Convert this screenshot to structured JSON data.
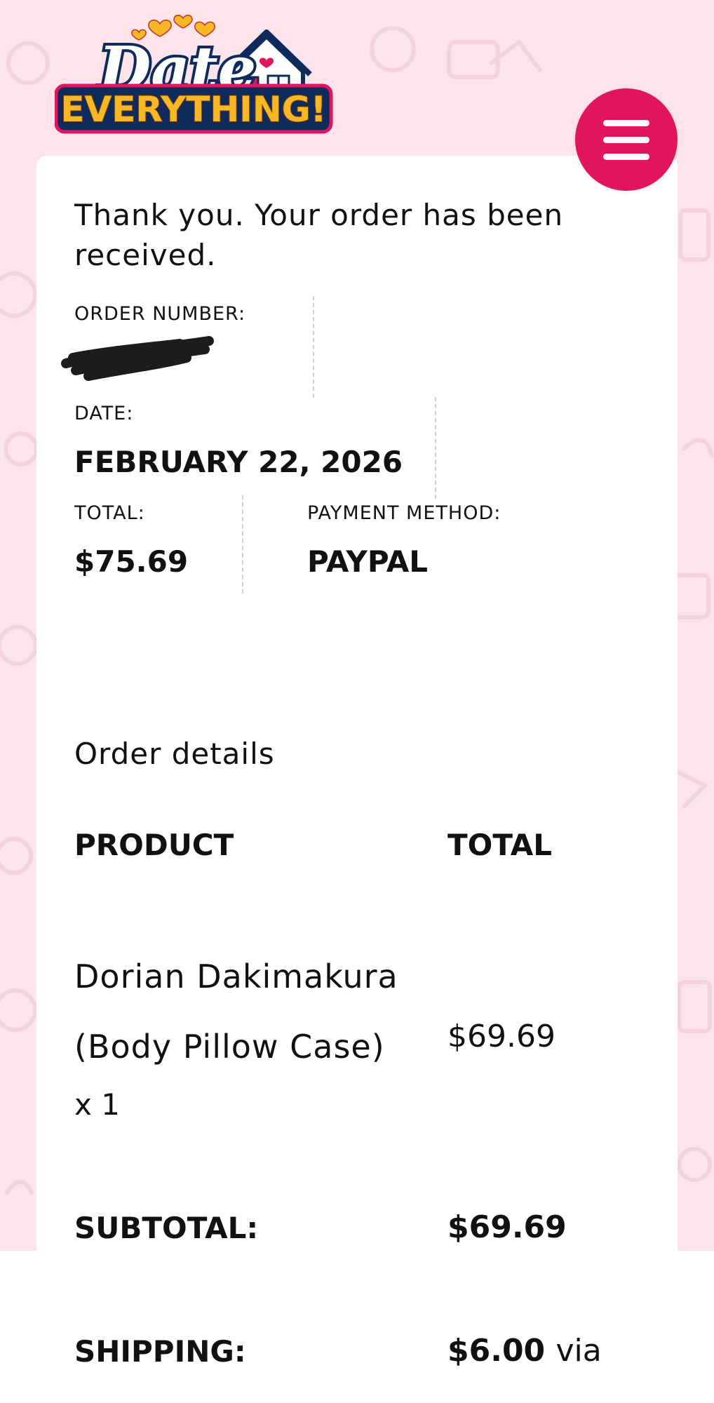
{
  "brand": {
    "logo_line1": "Date",
    "logo_line2": "EVERYTHING!"
  },
  "colors": {
    "background": "#fce4ea",
    "accent": "#e0155e",
    "logo_navy": "#0f2a5c",
    "logo_gold": "#f7b825"
  },
  "header": {
    "menu_icon": "hamburger-menu-icon"
  },
  "order": {
    "thank_you": "Thank you. Your order has been received.",
    "order_number_label": "ORDER NUMBER:",
    "date_label": "DATE:",
    "date_value": "FEBRUARY 22, 2026",
    "total_label": "TOTAL:",
    "total_value": "$75.69",
    "payment_label": "PAYMENT METHOD:",
    "payment_value": "PAYPAL"
  },
  "details": {
    "title": "Order details",
    "col_product": "PRODUCT",
    "col_total": "TOTAL",
    "items": [
      {
        "name": "Dorian Dakimakura (Body Pillow Case)",
        "qty": "x 1",
        "total": "$69.69"
      }
    ],
    "subtotal_label": "SUBTOTAL:",
    "subtotal_value": "$69.69",
    "shipping_label": "SHIPPING:",
    "shipping_value": "$6.00",
    "shipping_via": "via"
  }
}
